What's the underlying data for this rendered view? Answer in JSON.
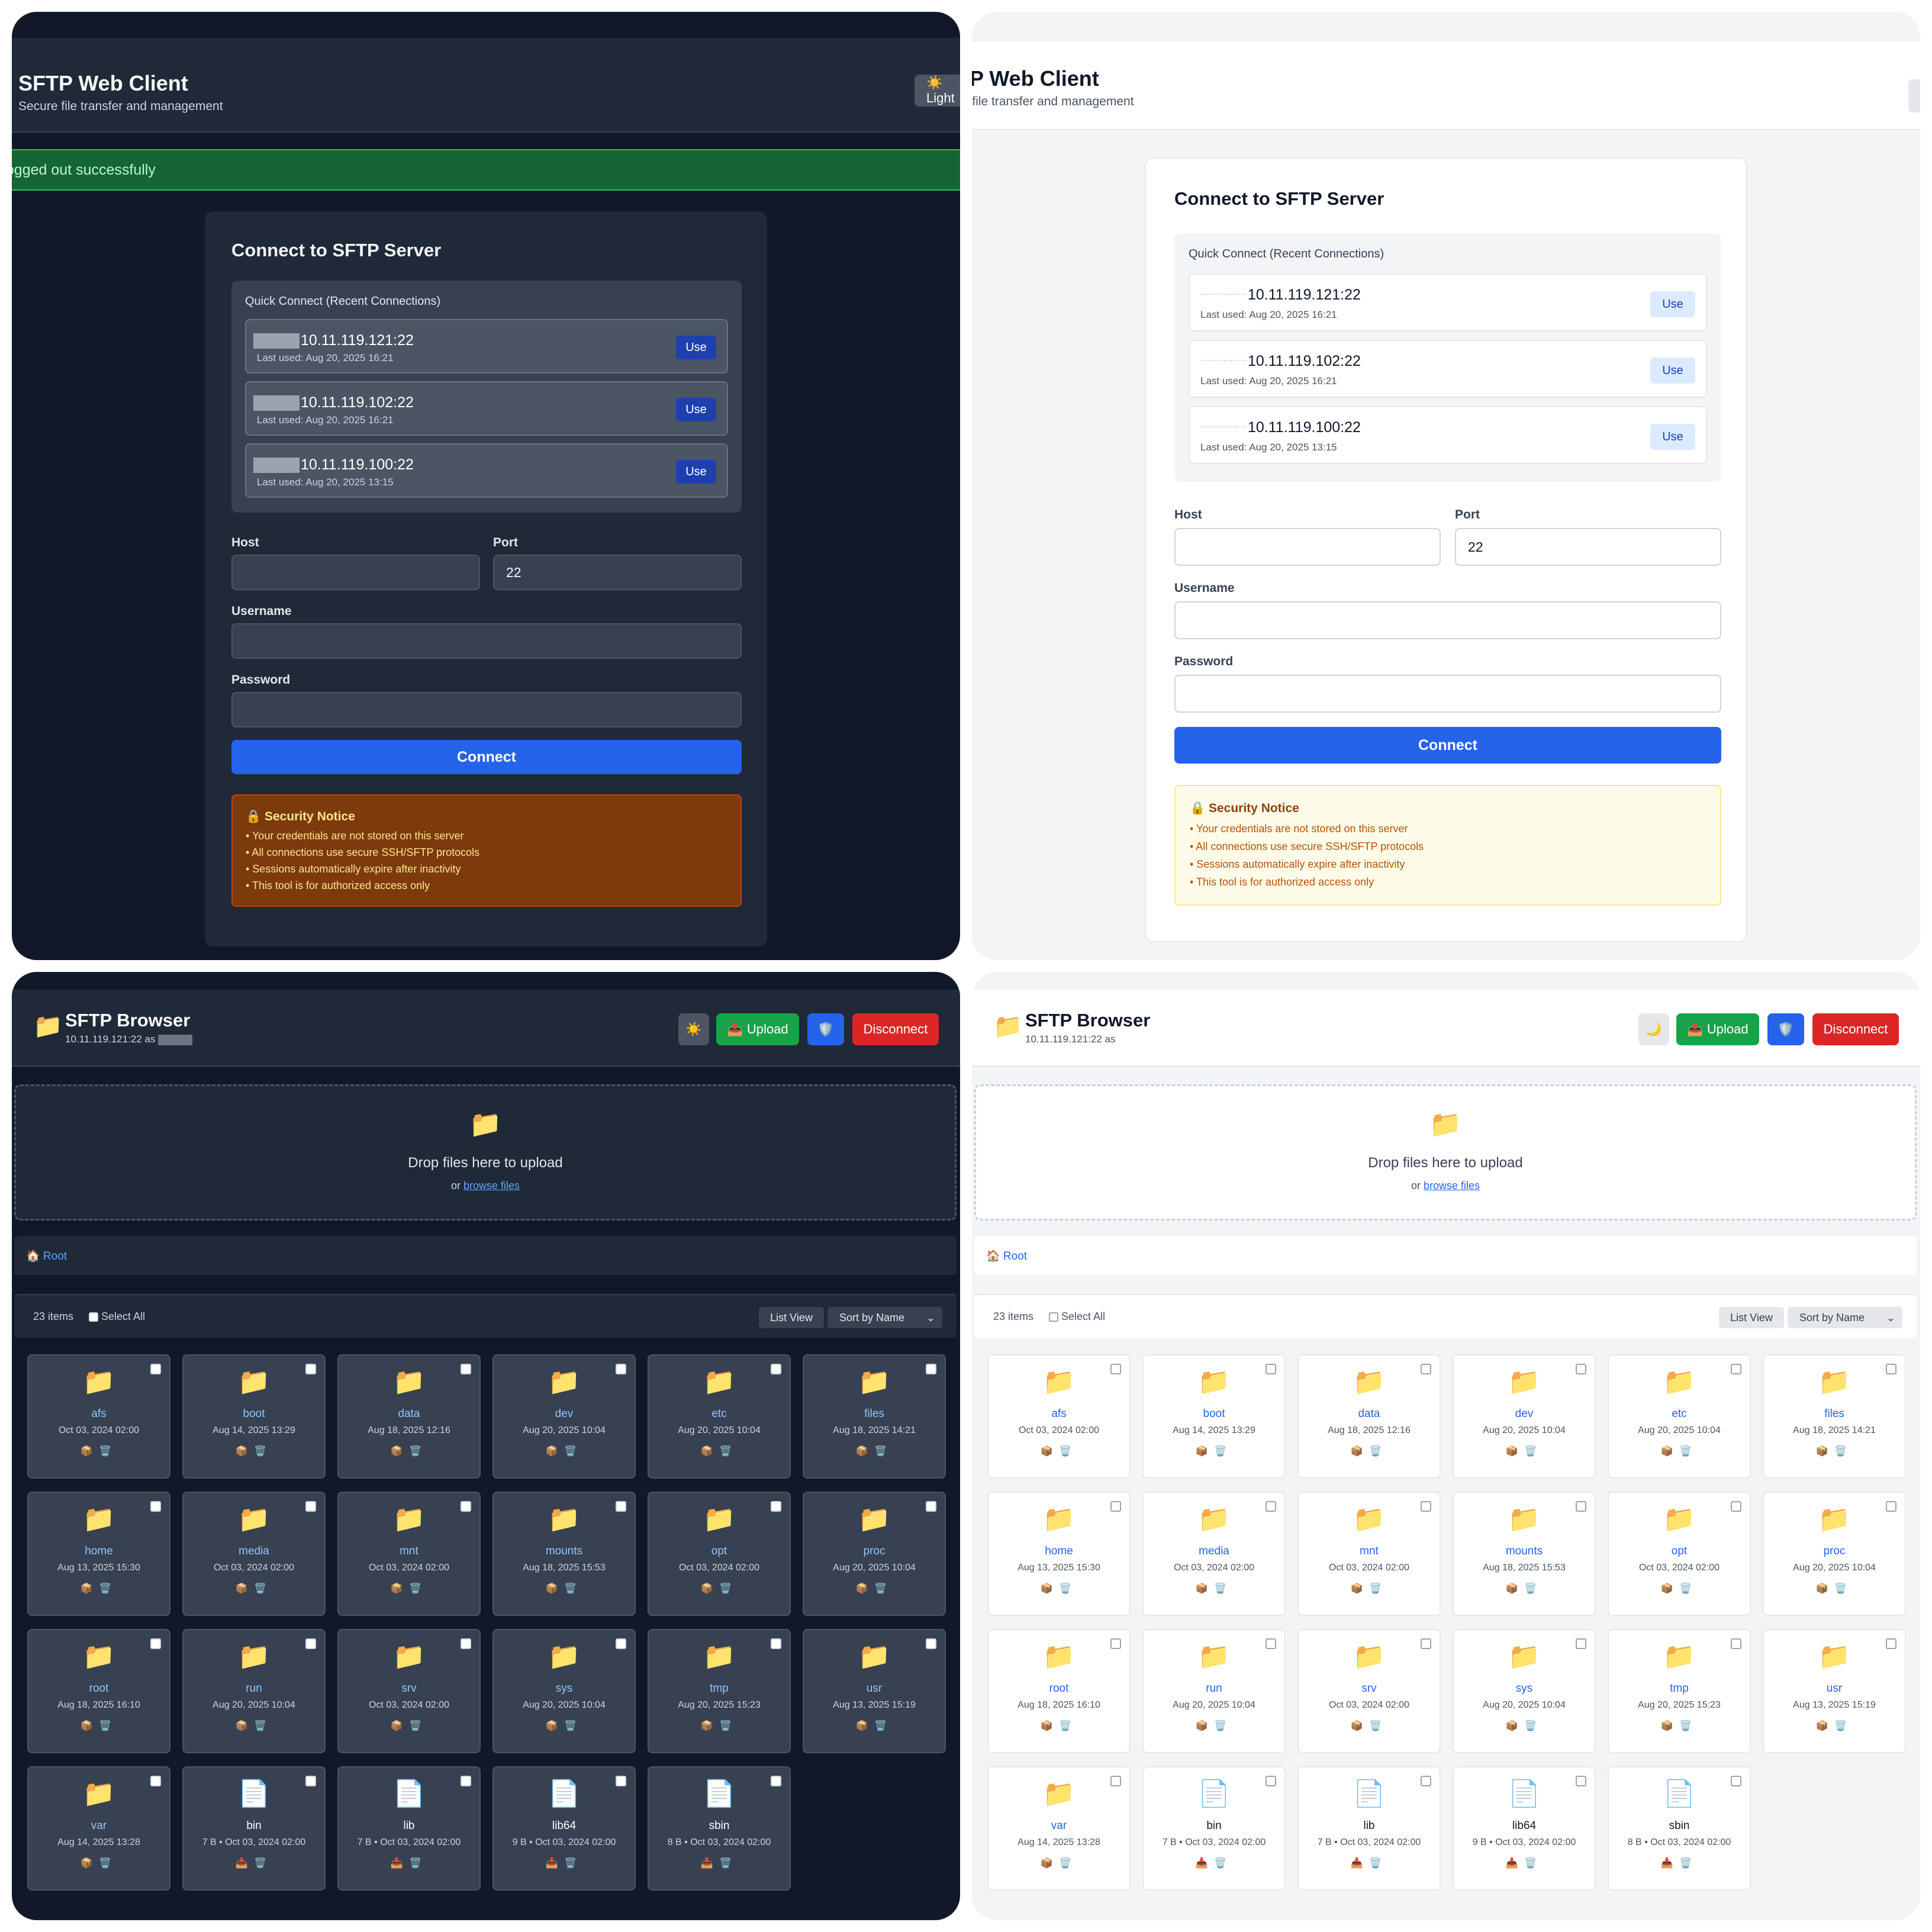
{
  "login": {
    "app_title": "SFTP Web Client",
    "app_subtitle": "Secure file transfer and management",
    "theme_toggle_label": "☀️ Light",
    "banner": "Logged out successfully",
    "card_title": "Connect to SFTP Server",
    "quick_connect_title": "Quick Connect (Recent Connections)",
    "recent": [
      {
        "host": "10.11.119.121:22",
        "last_used": "Last used: Aug 20, 2025 16:21",
        "use_label": "Use"
      },
      {
        "host": "10.11.119.102:22",
        "last_used": "Last used: Aug 20, 2025 16:21",
        "use_label": "Use"
      },
      {
        "host": "10.11.119.100:22",
        "last_used": "Last used: Aug 20, 2025 13:15",
        "use_label": "Use"
      }
    ],
    "host_label": "Host",
    "host_value": "",
    "port_label": "Port",
    "port_value": "22",
    "username_label": "Username",
    "username_value": "",
    "password_label": "Password",
    "password_value": "",
    "connect_label": "Connect",
    "security": {
      "title": "🔒 Security Notice",
      "lines": [
        "• Your credentials are not stored on this server",
        "• All connections use secure SSH/SFTP protocols",
        "• Sessions automatically expire after inactivity",
        "• This tool is for authorized access only"
      ]
    }
  },
  "browser": {
    "title": "SFTP Browser",
    "conn_info": "10.11.119.121:22 as",
    "theme_icon_dark": "☀️",
    "theme_icon_light": "🌙",
    "upload_label": "📤 Upload",
    "shield_icon": "🛡️",
    "disconnect_label": "Disconnect",
    "drop_icon": "📁",
    "drop_text": "Drop files here to upload",
    "drop_or": "or",
    "browse_label": "browse files",
    "breadcrumb": "🏠 Root",
    "item_count": "23 items",
    "select_all": "Select All",
    "view_label": "List View",
    "sort_label": "Sort by Name",
    "items": [
      {
        "name": "afs",
        "meta": "Oct 03, 2024 02:00",
        "type": "folder"
      },
      {
        "name": "boot",
        "meta": "Aug 14, 2025 13:29",
        "type": "folder"
      },
      {
        "name": "data",
        "meta": "Aug 18, 2025 12:16",
        "type": "folder"
      },
      {
        "name": "dev",
        "meta": "Aug 20, 2025 10:04",
        "type": "folder"
      },
      {
        "name": "etc",
        "meta": "Aug 20, 2025 10:04",
        "type": "folder"
      },
      {
        "name": "files",
        "meta": "Aug 18, 2025 14:21",
        "type": "folder"
      },
      {
        "name": "home",
        "meta": "Aug 13, 2025 15:30",
        "type": "folder"
      },
      {
        "name": "media",
        "meta": "Oct 03, 2024 02:00",
        "type": "folder"
      },
      {
        "name": "mnt",
        "meta": "Oct 03, 2024 02:00",
        "type": "folder"
      },
      {
        "name": "mounts",
        "meta": "Aug 18, 2025 15:53",
        "type": "folder"
      },
      {
        "name": "opt",
        "meta": "Oct 03, 2024 02:00",
        "type": "folder"
      },
      {
        "name": "proc",
        "meta": "Aug 20, 2025 10:04",
        "type": "folder"
      },
      {
        "name": "root",
        "meta": "Aug 18, 2025 16:10",
        "type": "folder"
      },
      {
        "name": "run",
        "meta": "Aug 20, 2025 10:04",
        "type": "folder"
      },
      {
        "name": "srv",
        "meta": "Oct 03, 2024 02:00",
        "type": "folder"
      },
      {
        "name": "sys",
        "meta": "Aug 20, 2025 10:04",
        "type": "folder"
      },
      {
        "name": "tmp",
        "meta": "Aug 20, 2025 15:23",
        "type": "folder"
      },
      {
        "name": "usr",
        "meta": "Aug 13, 2025 15:19",
        "type": "folder"
      },
      {
        "name": "var",
        "meta": "Aug 14, 2025 13:28",
        "type": "folder"
      },
      {
        "name": "bin",
        "meta": "7 B • Oct 03, 2024 02:00",
        "type": "file"
      },
      {
        "name": "lib",
        "meta": "7 B • Oct 03, 2024 02:00",
        "type": "file"
      },
      {
        "name": "lib64",
        "meta": "9 B • Oct 03, 2024 02:00",
        "type": "file"
      },
      {
        "name": "sbin",
        "meta": "8 B • Oct 03, 2024 02:00",
        "type": "file"
      }
    ],
    "folder_icon": "📁",
    "file_icon": "📄",
    "folder_actions": "📦🗑️",
    "file_actions": "📥🗑️"
  },
  "colors": {
    "dark_bg": "#111827",
    "light_bg": "#f3f4f6",
    "primary": "#2563eb",
    "success": "#16a34a",
    "danger": "#dc2626"
  }
}
